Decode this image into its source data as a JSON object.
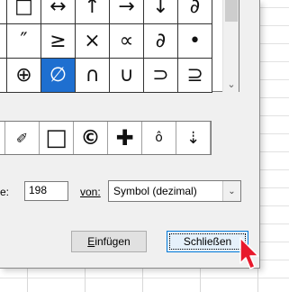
{
  "grid": {
    "rows": [
      [
        "",
        "□",
        "↔",
        "↑",
        "→",
        "↓",
        "∂"
      ],
      [
        "",
        "″",
        "≥",
        "×",
        "∝",
        "∂",
        "•"
      ],
      [
        "",
        "⊕",
        "∅",
        "∩",
        "∪",
        "⊃",
        "⊇"
      ]
    ],
    "selected": "∅"
  },
  "recent": [
    "✐",
    "□",
    "©",
    "✚",
    "ô",
    "⇣"
  ],
  "code": {
    "label": "e:",
    "value": "198"
  },
  "from": {
    "label": "von:",
    "value": "Symbol (dezimal)"
  },
  "buttons": {
    "insert": "Einfügen",
    "close": "Schließen"
  },
  "colors": {
    "selection": "#1e6fd0",
    "focus_border": "#0078d7",
    "cursor": "#e8192c"
  }
}
